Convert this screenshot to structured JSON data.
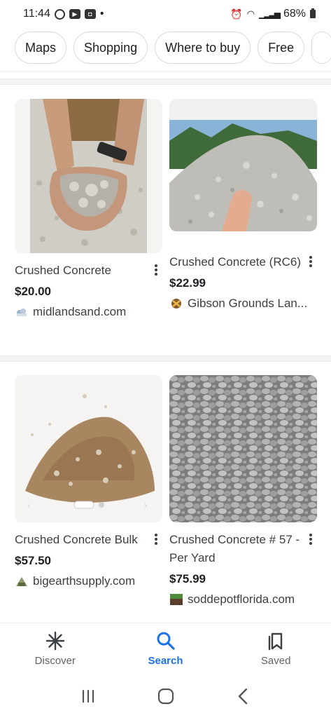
{
  "status_bar": {
    "time": "11:44",
    "battery": "68%"
  },
  "chips": [
    "Maps",
    "Shopping",
    "Where to buy",
    "Free"
  ],
  "products": [
    {
      "title": "Crushed Concrete",
      "price": "$20.00",
      "seller": "midlandsand.com",
      "image": "hands-holding-crushed-concrete",
      "icon": "midlandsand-logo-icon"
    },
    {
      "title": "Crushed Concrete (RC6)",
      "price": "$22.99",
      "seller": "Gibson Grounds Lan...",
      "image": "crushed-concrete-pile-outdoors",
      "icon": "gibson-grounds-logo-icon"
    },
    {
      "title": "Crushed Concrete Bulk",
      "price": "$57.50",
      "seller": "bigearthsupply.com",
      "image": "crushed-concrete-dirt-pile",
      "icon": "bigearthsupply-logo-icon"
    },
    {
      "title": "Crushed Concrete # 57 - Per Yard",
      "price": "$75.99",
      "seller": "soddepotflorida.com",
      "image": "gray-gravel-closeup",
      "icon": "soddepot-logo-icon"
    }
  ],
  "bottom_nav": {
    "discover": "Discover",
    "search": "Search",
    "saved": "Saved"
  },
  "colors": {
    "accent": "#1a73e8",
    "text": "#202124",
    "secondary_text": "#5f6368"
  }
}
